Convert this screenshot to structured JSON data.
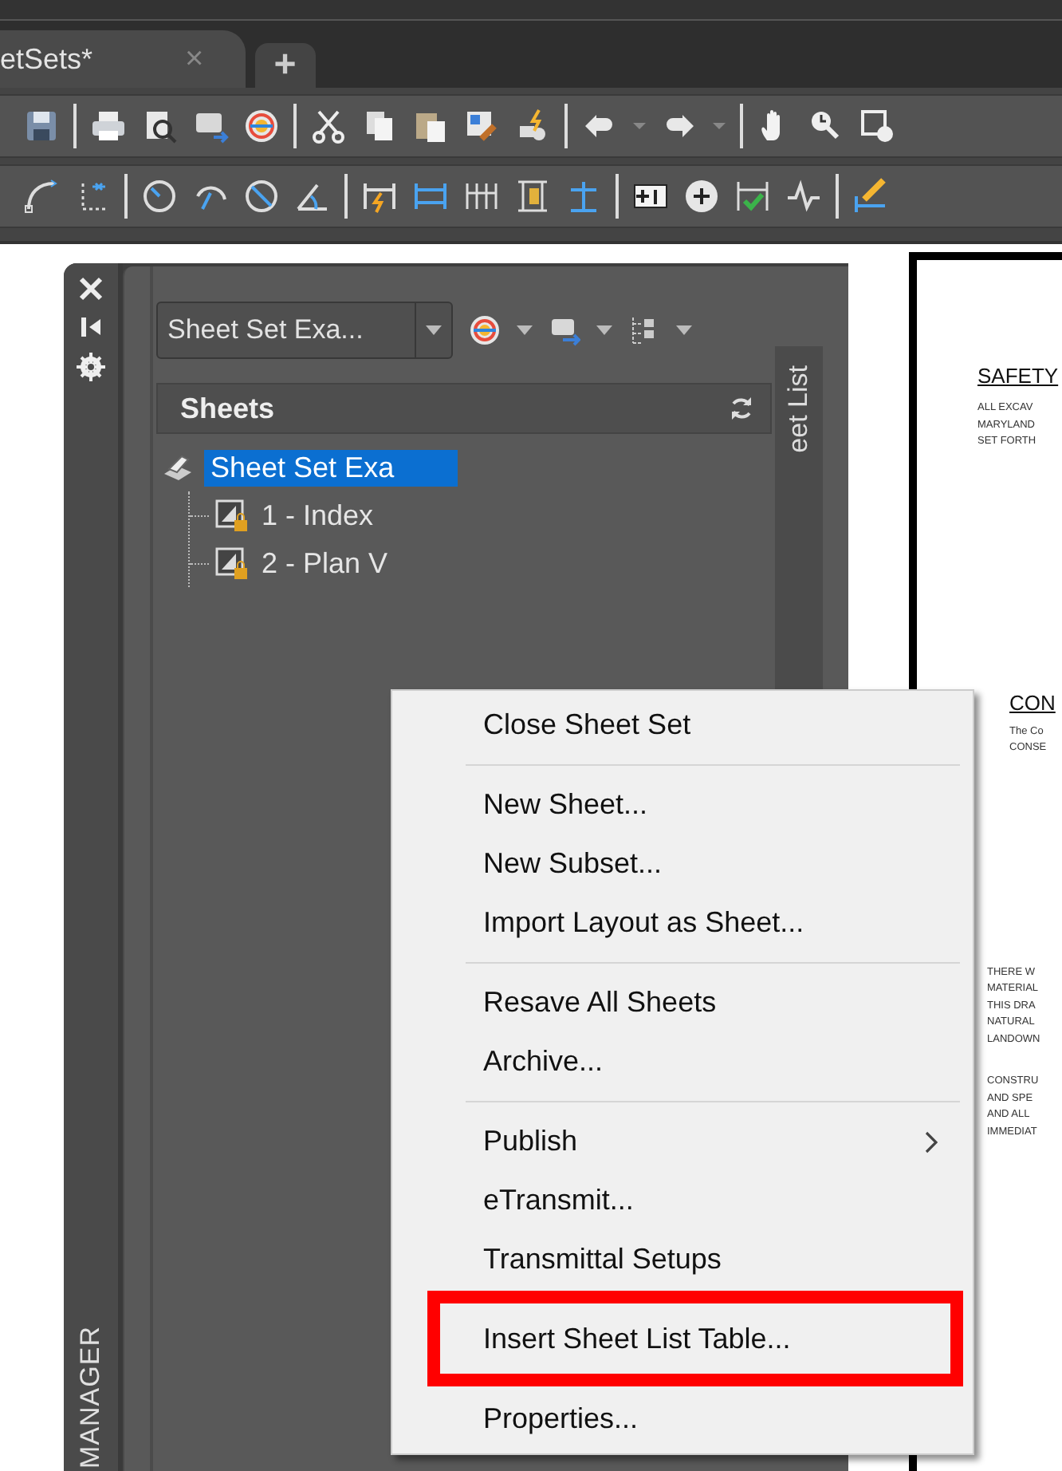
{
  "document_tabs": [
    {
      "label": "etSets*",
      "close": "×",
      "selected": true
    }
  ],
  "new_tab": "+",
  "palette": {
    "title": "MANAGER",
    "sheet_set_dropdown": "Sheet Set Exa...",
    "sheets_header": "Sheets",
    "side_tab": "eet List",
    "tree": [
      {
        "label": "Sheet Set Exa",
        "selected": true,
        "children": [
          {
            "label": "1 - Index",
            "selected": false
          },
          {
            "label": "2 - Plan V",
            "selected": false
          }
        ]
      }
    ]
  },
  "context_menu": {
    "groups": [
      [
        {
          "label": "Close Sheet Set",
          "submenu": false,
          "highlighted": false
        }
      ],
      [
        {
          "label": "New Sheet...",
          "submenu": false,
          "highlighted": false
        },
        {
          "label": "New Subset...",
          "submenu": false,
          "highlighted": false
        },
        {
          "label": "Import Layout as Sheet...",
          "submenu": false,
          "highlighted": false
        }
      ],
      [
        {
          "label": "Resave All Sheets",
          "submenu": false,
          "highlighted": false
        },
        {
          "label": "Archive...",
          "submenu": false,
          "highlighted": false
        }
      ],
      [
        {
          "label": "Publish",
          "submenu": true,
          "highlighted": false
        },
        {
          "label": "eTransmit...",
          "submenu": false,
          "highlighted": false
        },
        {
          "label": "Transmittal Setups",
          "submenu": false,
          "highlighted": false
        }
      ],
      [
        {
          "label": "Insert Sheet List Table...",
          "submenu": false,
          "highlighted": true
        }
      ],
      [
        {
          "label": "Properties...",
          "submenu": false,
          "highlighted": false
        }
      ]
    ]
  },
  "drawing": {
    "sections": [
      {
        "kind": "heading",
        "text": "SAFETY"
      },
      {
        "kind": "lines",
        "lines": [
          "ALL EXCAV",
          "MARYLAND",
          "SET FORTH"
        ]
      },
      {
        "kind": "heading",
        "text": "CON"
      },
      {
        "kind": "lines",
        "lines": [
          "The Co",
          "CONSE"
        ]
      },
      {
        "kind": "lines",
        "lines": [
          "THERE W",
          "MATERIAL",
          "THIS DRA",
          "NATURAL",
          "LANDOWN"
        ]
      },
      {
        "kind": "lines",
        "lines": [
          "CONSTRU",
          "AND SPE",
          "AND ALL",
          "IMMEDIAT"
        ]
      }
    ]
  }
}
